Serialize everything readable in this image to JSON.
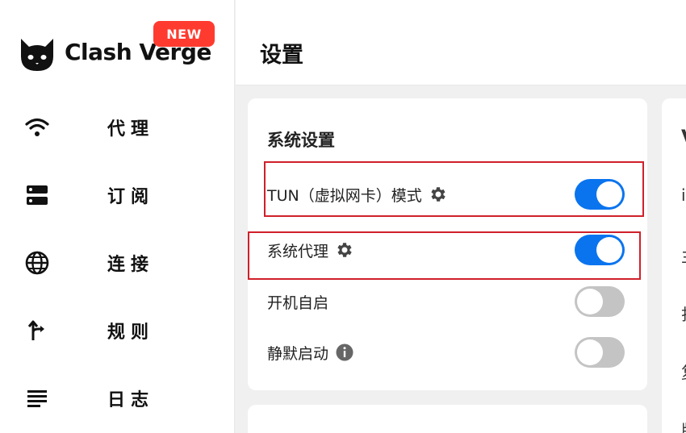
{
  "app": {
    "name": "Clash Verge",
    "badge": "NEW"
  },
  "sidebar": {
    "items": [
      {
        "label": "代理",
        "icon": "wifi-icon"
      },
      {
        "label": "订阅",
        "icon": "storage-icon"
      },
      {
        "label": "连接",
        "icon": "globe-icon"
      },
      {
        "label": "规则",
        "icon": "fork-arrow-icon"
      },
      {
        "label": "日志",
        "icon": "lines-icon"
      }
    ]
  },
  "header": {
    "title": "设置"
  },
  "system_settings": {
    "title": "系统设置",
    "rows": [
      {
        "label": "TUN（虚拟网卡）模式",
        "icon": "gear-icon",
        "enabled": true
      },
      {
        "label": "系统代理",
        "icon": "gear-icon",
        "enabled": true
      },
      {
        "label": "开机自启",
        "icon": "",
        "enabled": false
      },
      {
        "label": "静默启动",
        "icon": "info-icon",
        "enabled": false
      }
    ]
  },
  "right_card_peek": {
    "title_fragment": "V",
    "row_fragments": [
      "i",
      "主",
      "打",
      "复",
      "版"
    ]
  },
  "colors": {
    "accent": "#0a74ef",
    "toggle_off": "#c4c4c4",
    "badge": "#ff3b30",
    "highlight": "#d0202a"
  }
}
